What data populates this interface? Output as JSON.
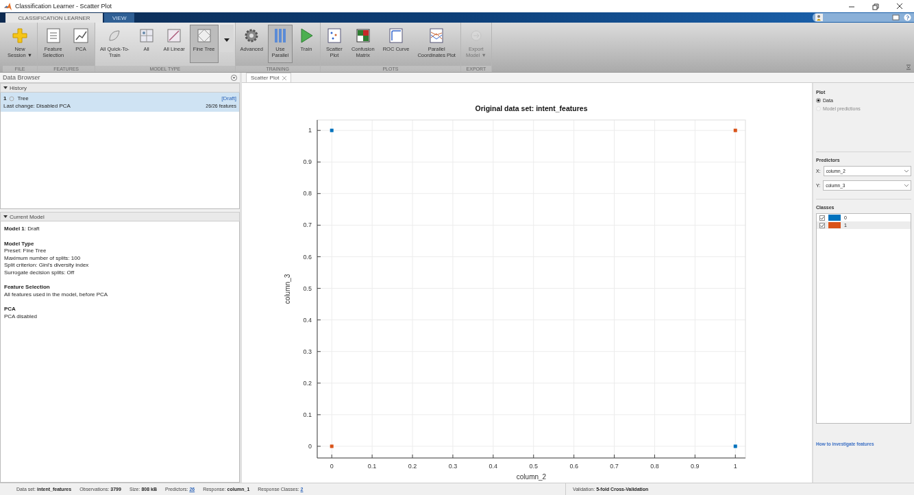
{
  "window": {
    "title": "Classification Learner - Scatter Plot"
  },
  "tabs": [
    {
      "label": "CLASSIFICATION LEARNER",
      "selected": true
    },
    {
      "label": "VIEW",
      "selected": false
    }
  ],
  "ribbon": [
    {
      "title": "FILE",
      "gallery": false,
      "items": [
        {
          "label": "New\nSession ▼",
          "selected": false,
          "disabled": false
        }
      ]
    },
    {
      "title": "FEATURES",
      "gallery": false,
      "items": [
        {
          "label": "Feature\nSelection",
          "selected": false,
          "disabled": false
        },
        {
          "label": "PCA",
          "selected": false,
          "disabled": false
        }
      ]
    },
    {
      "title": "MODEL TYPE",
      "gallery": true,
      "items": [
        {
          "label": "All Quick-To-\nTrain",
          "selected": false,
          "disabled": false
        },
        {
          "label": "All",
          "selected": false,
          "disabled": false
        },
        {
          "label": "All Linear",
          "selected": false,
          "disabled": false
        },
        {
          "label": "Fine Tree",
          "selected": true,
          "disabled": false
        }
      ]
    },
    {
      "title": "TRAINING",
      "gallery": false,
      "items": [
        {
          "label": "Advanced",
          "selected": false,
          "disabled": false
        },
        {
          "label": "Use\nParallel",
          "selected": true,
          "disabled": false
        },
        {
          "label": "Train",
          "selected": false,
          "disabled": false
        }
      ]
    },
    {
      "title": "PLOTS",
      "gallery": false,
      "items": [
        {
          "label": "Scatter\nPlot",
          "selected": false,
          "disabled": false
        },
        {
          "label": "Confusion\nMatrix",
          "selected": false,
          "disabled": false
        },
        {
          "label": "ROC Curve",
          "selected": false,
          "disabled": false
        },
        {
          "label": "Parallel\nCoordinates Plot",
          "selected": false,
          "disabled": false
        }
      ]
    },
    {
      "title": "EXPORT",
      "gallery": false,
      "items": [
        {
          "label": "Export\nModel ▼",
          "selected": false,
          "disabled": true
        }
      ]
    }
  ],
  "data_browser": {
    "title": "Data Browser",
    "history": {
      "title": "History",
      "expanded": true,
      "items": [
        {
          "number": "1",
          "name": "Tree",
          "status": "[Draft]",
          "last_change": "Last change: Disabled PCA",
          "features": "26/26 features",
          "selected": true
        }
      ]
    },
    "current_model": {
      "title": "Current Model",
      "expanded": true,
      "heading": "**Model 1**: Draft",
      "sections": [
        {
          "title": "Model Type",
          "lines": [
            "Preset: Fine Tree",
            "Maximum number of splits: 100",
            "Split criterion: Gini's diversity index",
            "Surrogate decision splits: Off"
          ]
        },
        {
          "title": "Feature Selection",
          "lines": [
            "All features used in the model, before PCA"
          ]
        },
        {
          "title": "PCA",
          "lines": [
            "PCA disabled"
          ]
        }
      ]
    }
  },
  "document_tabs": [
    {
      "label": "Scatter Plot",
      "selected": true
    }
  ],
  "plot": {
    "chart_data": {
      "type": "scatter",
      "title": "Original data set: intent_features",
      "xlabel": "column_2",
      "ylabel": "column_3",
      "x": [
        0,
        1
      ],
      "series": [
        {
          "color": "#0072bd",
          "values": [
            1,
            0
          ]
        },
        {
          "color": "#d95319",
          "values": [
            0,
            1
          ]
        }
      ],
      "grid": true,
      "xlim": [
        -0.036,
        1.025
      ],
      "ylim": [
        -0.037,
        1.033
      ],
      "xticks": [
        0,
        0.1,
        0.2,
        0.3,
        0.4,
        0.5,
        0.6,
        0.7,
        0.8,
        0.9,
        1
      ],
      "yticks": [
        0,
        0.1,
        0.2,
        0.3,
        0.4,
        0.5,
        0.6,
        0.7,
        0.8,
        0.9,
        1
      ]
    }
  },
  "controls": {
    "plot": {
      "title": "Plot",
      "options": [
        {
          "label": "Data",
          "selected": true,
          "disabled": false
        },
        {
          "label": "Model predictions",
          "selected": false,
          "disabled": true
        }
      ]
    },
    "predictors": {
      "title": "Predictors",
      "fields": [
        {
          "label": "X:",
          "value": "column_2"
        },
        {
          "label": "Y:",
          "value": "column_3"
        }
      ]
    },
    "classes": {
      "title": "Classes",
      "items": [
        {
          "label": "0",
          "checked": true,
          "color": "#0072bd",
          "selected": false
        },
        {
          "label": "1",
          "checked": true,
          "color": "#d95319",
          "selected": true
        }
      ]
    },
    "link": "How to investigate features"
  },
  "status_bar": {
    "items": [
      {
        "label": "Data set:",
        "value": "intent_features",
        "kind": "bold"
      },
      {
        "label": "Observations:",
        "value": "3799",
        "kind": "bold"
      },
      {
        "label": "Size:",
        "value": "808 kB",
        "kind": "bold"
      },
      {
        "label": "Predictors:",
        "value": "26",
        "kind": "link"
      },
      {
        "label": "Response:",
        "value": "column_1",
        "kind": "bold"
      },
      {
        "label": "Response Classes:",
        "value": "2",
        "kind": "link"
      }
    ],
    "validation": {
      "label": "Validation:",
      "value": "5-fold Cross-Validation"
    }
  }
}
